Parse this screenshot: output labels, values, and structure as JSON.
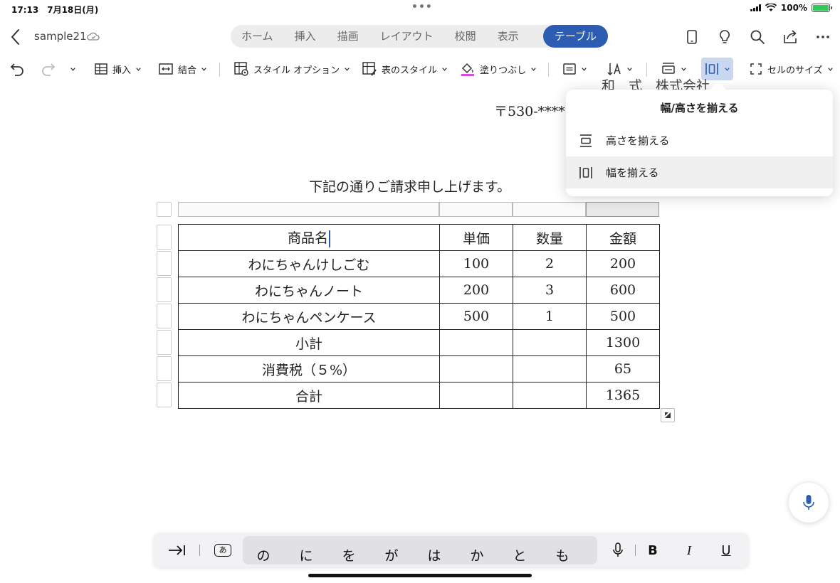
{
  "status": {
    "time": "17:13",
    "date": "7月18日(月)",
    "battery": "100%"
  },
  "title": {
    "doc_name": "sample21"
  },
  "ribbon_tabs": [
    "ホーム",
    "挿入",
    "描画",
    "レイアウト",
    "校閲",
    "表示",
    "テーブル"
  ],
  "active_tab": "テーブル",
  "toolbar": {
    "insert": "挿入",
    "merge": "結合",
    "style_options": "スタイル オプション",
    "table_styles": "表のスタイル",
    "shading": "塗りつぶし",
    "cell_size": "セルのサイズ"
  },
  "document": {
    "partial_header": "和　式　株式会社",
    "postal": "〒530-****",
    "intro": "下記の通りご請求申し上げます。",
    "table": {
      "header": [
        "商品名",
        "単価",
        "数量",
        "金額"
      ],
      "rows": [
        [
          "わにちゃんけしごむ",
          "100",
          "2",
          "200"
        ],
        [
          "わにちゃんノート",
          "200",
          "3",
          "600"
        ],
        [
          "わにちゃんペンケース",
          "500",
          "1",
          "500"
        ],
        [
          "小計",
          "",
          "",
          "1300"
        ],
        [
          "消費税（５%）",
          "",
          "",
          "65"
        ],
        [
          "合計",
          "",
          "",
          "1365"
        ]
      ]
    }
  },
  "popover": {
    "title": "幅/高さを揃える",
    "items": [
      "高さを揃える",
      "幅を揃える"
    ],
    "highlighted": "幅を揃える"
  },
  "keyboard": {
    "candidates": [
      "の",
      "に",
      "を",
      "が",
      "は",
      "か",
      "と",
      "も"
    ],
    "kana_key": "あ",
    "bold": "B",
    "italic": "I",
    "underline": "U"
  }
}
